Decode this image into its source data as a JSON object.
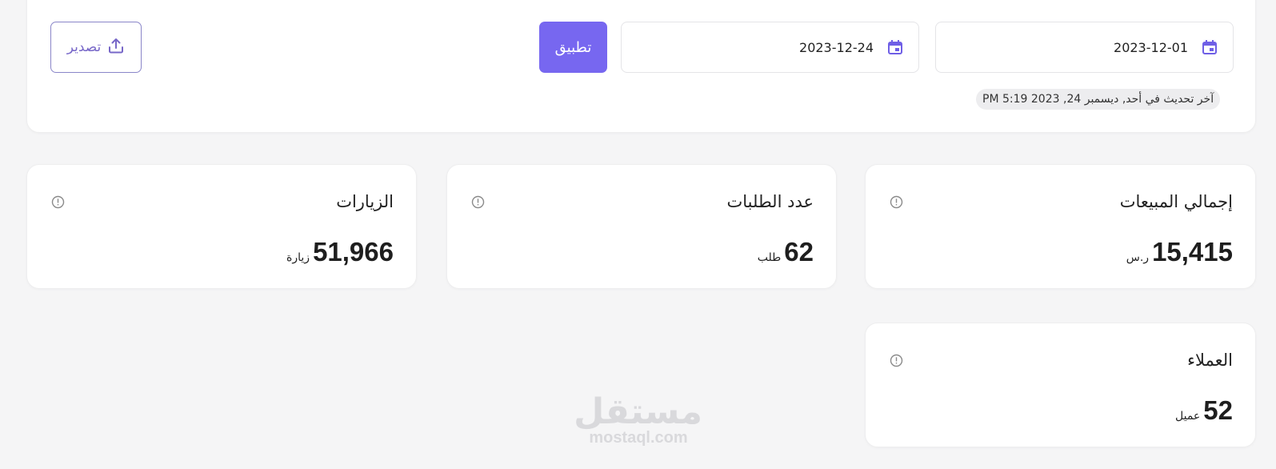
{
  "filters": {
    "date_from": "2023-12-01",
    "date_to": "2023-12-24",
    "apply_label": "تطبيق",
    "export_label": "تصدير",
    "last_updated": "آخر تحديث في أحد, ديسمبر 24, 2023 5:19 PM"
  },
  "stats": [
    {
      "title": "إجمالي المبيعات",
      "value": "15,415",
      "unit": "ر.س"
    },
    {
      "title": "عدد الطلبات",
      "value": "62",
      "unit": "طلب"
    },
    {
      "title": "الزيارات",
      "value": "51,966",
      "unit": "زيارة"
    },
    {
      "title": "العملاء",
      "value": "52",
      "unit": "عميل"
    }
  ],
  "watermark": {
    "arabic": "مستقل",
    "latin": "mostaql.com"
  },
  "colors": {
    "accent": "#7767f0",
    "background": "#f5f5f6",
    "card": "#ffffff"
  },
  "icons": {
    "calendar": "calendar-icon",
    "export": "upload-icon",
    "info": "info-icon"
  }
}
